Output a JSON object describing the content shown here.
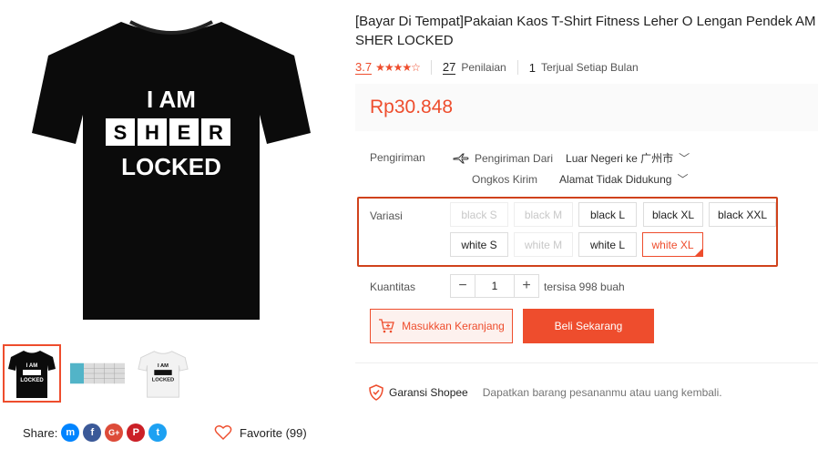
{
  "product": {
    "title": "[Bayar Di Tempat]Pakaian Kaos T-Shirt Fitness Leher O Lengan Pendek AM SHER LOCKED",
    "shirt_text": [
      "I AM",
      "S",
      "H",
      "E",
      "R",
      "LOCKED"
    ],
    "rating": "3.7",
    "stars_display": "★★★★☆",
    "reviews_count": "27",
    "reviews_label": "Penilaian",
    "sold_count": "1",
    "sold_label": "Terjual Setiap Bulan",
    "price": "Rp30.848"
  },
  "shipping": {
    "label": "Pengiriman",
    "from_label": "Pengiriman Dari",
    "from_value": "Luar Negeri ke 广州市",
    "cost_label": "Ongkos Kirim",
    "cost_value": "Alamat Tidak Didukung"
  },
  "variation": {
    "label": "Variasi",
    "options": [
      {
        "label": "black S",
        "state": "disabled"
      },
      {
        "label": "black M",
        "state": "disabled"
      },
      {
        "label": "black L",
        "state": "normal"
      },
      {
        "label": "black XL",
        "state": "normal"
      },
      {
        "label": "black XXL",
        "state": "normal"
      },
      {
        "label": "white S",
        "state": "normal"
      },
      {
        "label": "white M",
        "state": "disabled"
      },
      {
        "label": "white L",
        "state": "normal"
      },
      {
        "label": "white XL",
        "state": "selected"
      }
    ]
  },
  "quantity": {
    "label": "Kuantitas",
    "value": "1",
    "minus": "−",
    "plus": "+",
    "stock": "tersisa 998 buah"
  },
  "actions": {
    "cart": "Masukkan Keranjang",
    "buy": "Beli Sekarang"
  },
  "guarantee": {
    "label": "Garansi Shopee",
    "desc": "Dapatkan barang pesananmu atau uang kembali."
  },
  "social": {
    "share_label": "Share:",
    "favorite_label": "Favorite (99)"
  },
  "colors": {
    "accent": "#ee4d2d",
    "border_highlight": "#d0421c"
  }
}
